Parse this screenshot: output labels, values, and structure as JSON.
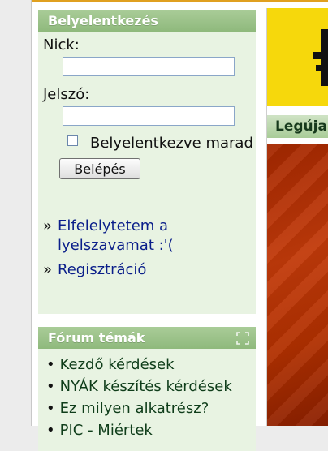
{
  "login": {
    "title": "Belyelentkezés",
    "nick_label": "Nick:",
    "nick_value": "",
    "password_label": "Jelszó:",
    "password_value": "",
    "remember_label": "Belyelentkezve marad",
    "submit_label": "Belépés",
    "links": [
      {
        "label": "Elfelelytetem a lyelszavamat :'("
      },
      {
        "label": "Regisztráció"
      }
    ]
  },
  "forum": {
    "title": "Fórum témák",
    "items": [
      "Kezdő kérdések",
      "NYÁK készítés kérdések",
      "Ez milyen alkatrész?",
      "PIC - Miértek"
    ]
  },
  "right": {
    "bar_title": "Legújabb"
  },
  "colors": {
    "header_green": "#8fb97c",
    "panel_green": "#e8f3e2",
    "link_blue": "#0b1f8a",
    "banner_yellow": "#f6d80c",
    "image_red": "#b13000"
  }
}
